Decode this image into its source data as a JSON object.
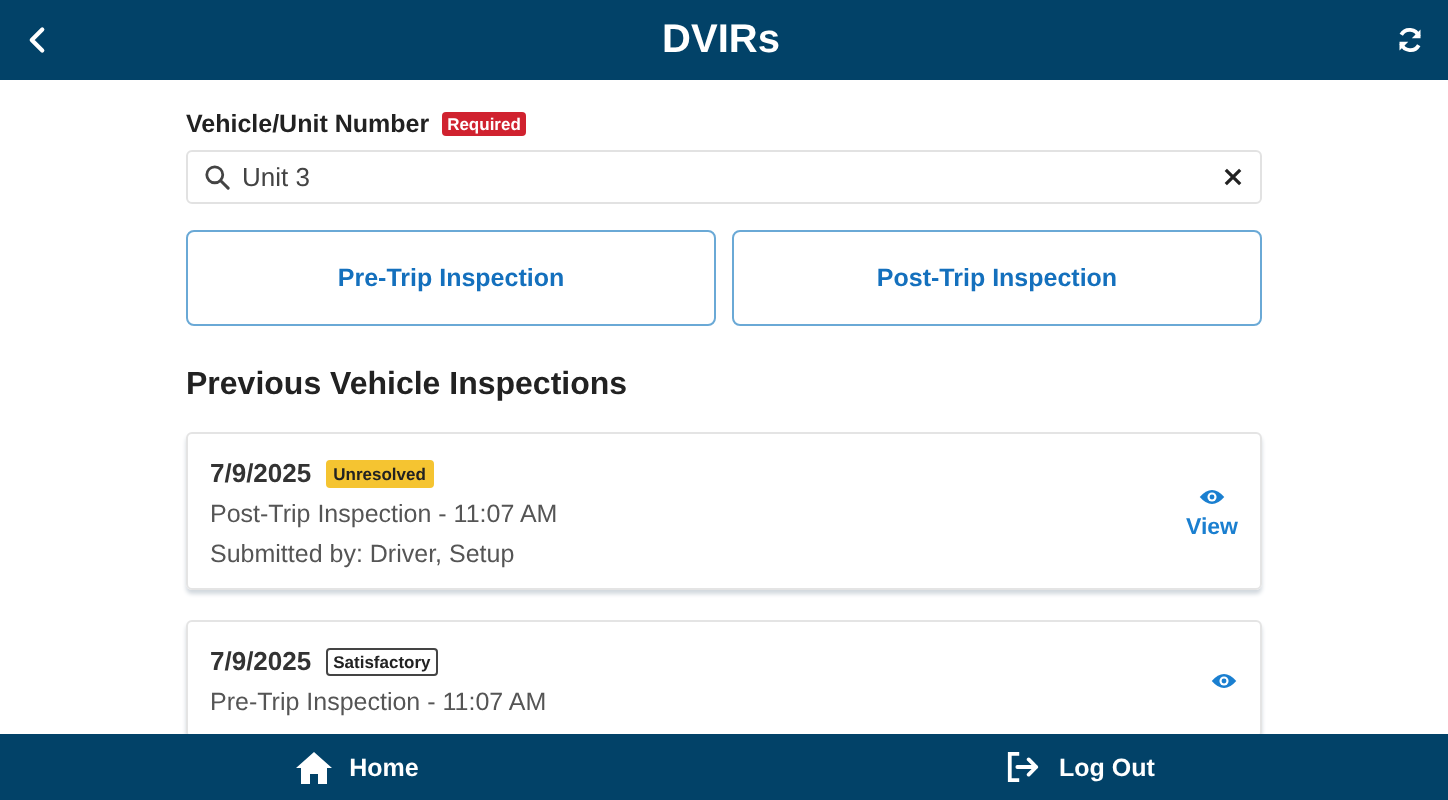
{
  "header": {
    "title": "DVIRs"
  },
  "vehicle_field": {
    "label": "Vehicle/Unit Number",
    "required_badge": "Required",
    "value": "Unit 3"
  },
  "inspection_buttons": [
    "Pre-Trip Inspection",
    "Post-Trip Inspection"
  ],
  "section_title": "Previous Vehicle Inspections",
  "inspections": [
    {
      "date": "7/9/2025",
      "status": "Unresolved",
      "kind": "unresolved",
      "type_time": "Post-Trip Inspection - 11:07 AM",
      "submitted_by": "Submitted by: Driver, Setup",
      "view_label": "View"
    },
    {
      "date": "7/9/2025",
      "status": "Satisfactory",
      "kind": "satisfactory",
      "type_time": "Pre-Trip Inspection - 11:07 AM"
    }
  ],
  "bottom_nav": [
    {
      "label": "Home",
      "kind": "home"
    },
    {
      "label": "Log Out",
      "kind": "logout"
    }
  ]
}
